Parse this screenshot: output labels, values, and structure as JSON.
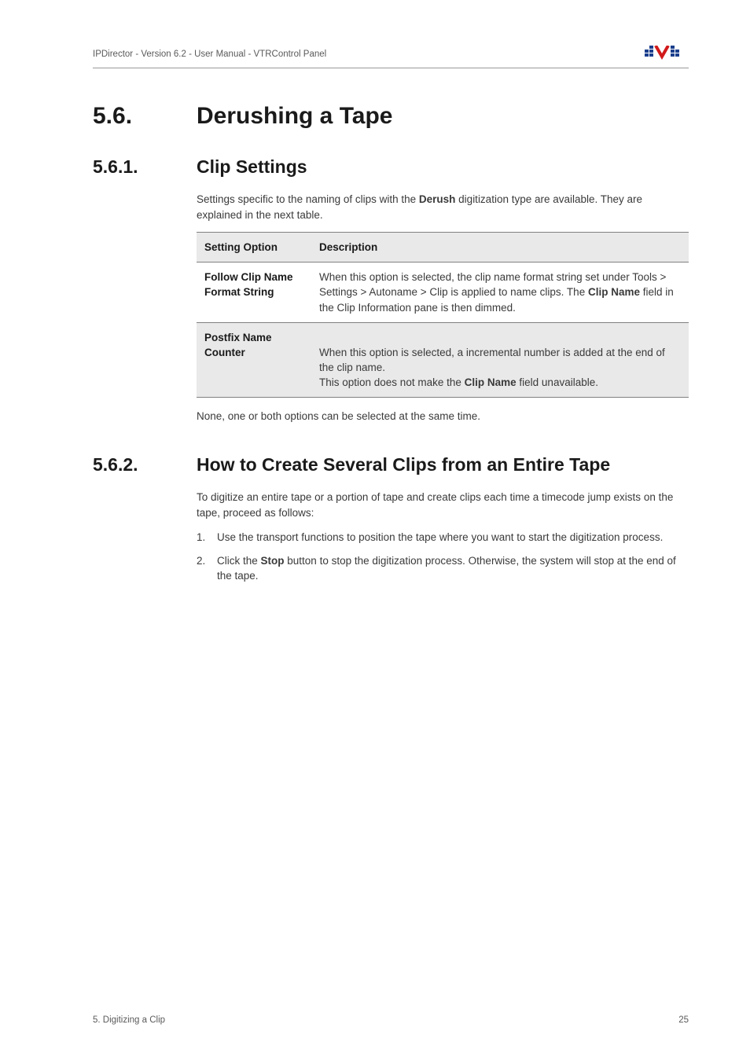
{
  "header": {
    "doc_title": "IPDirector - Version 6.2 - User Manual - VTRControl Panel"
  },
  "section": {
    "num": "5.6.",
    "title": "Derushing a Tape"
  },
  "sub1": {
    "num": "5.6.1.",
    "title": "Clip Settings",
    "intro_a": "Settings specific to the naming of clips with the ",
    "intro_b": "Derush",
    "intro_c": " digitization type are available. They are explained in the next table.",
    "table": {
      "head_opt": "Setting Option",
      "head_desc": "Description",
      "rows": [
        {
          "opt": "Follow Clip Name Format String",
          "desc_a": "When this option is selected, the clip name format string set under Tools > Settings > Autoname > Clip is applied to name clips. The ",
          "desc_b": "Clip Name",
          "desc_c": " field in the Clip Information pane is then dimmed."
        },
        {
          "opt": "Postfix Name Counter",
          "desc_a": "When this option is selected, a incremental number is added at the end of the clip name.\nThis option does not make the ",
          "desc_b": "Clip Name",
          "desc_c": " field unavailable."
        }
      ]
    },
    "outro": "None, one or both options can be selected at the same time."
  },
  "sub2": {
    "num": "5.6.2.",
    "title": "How to Create Several Clips from an Entire Tape",
    "intro": "To digitize an entire tape or a portion of tape and create clips each time a timecode jump exists on the tape, proceed as follows:",
    "steps": [
      {
        "a": "Use the transport functions to position the tape where you want to start the digitization process.",
        "b": "",
        "c": ""
      },
      {
        "a": "Click the ",
        "b": "Stop",
        "c": " button to stop the digitization process. Otherwise, the system will stop at the end of the tape."
      }
    ]
  },
  "footer": {
    "left": "5. Digitizing a Clip",
    "right": "25"
  }
}
